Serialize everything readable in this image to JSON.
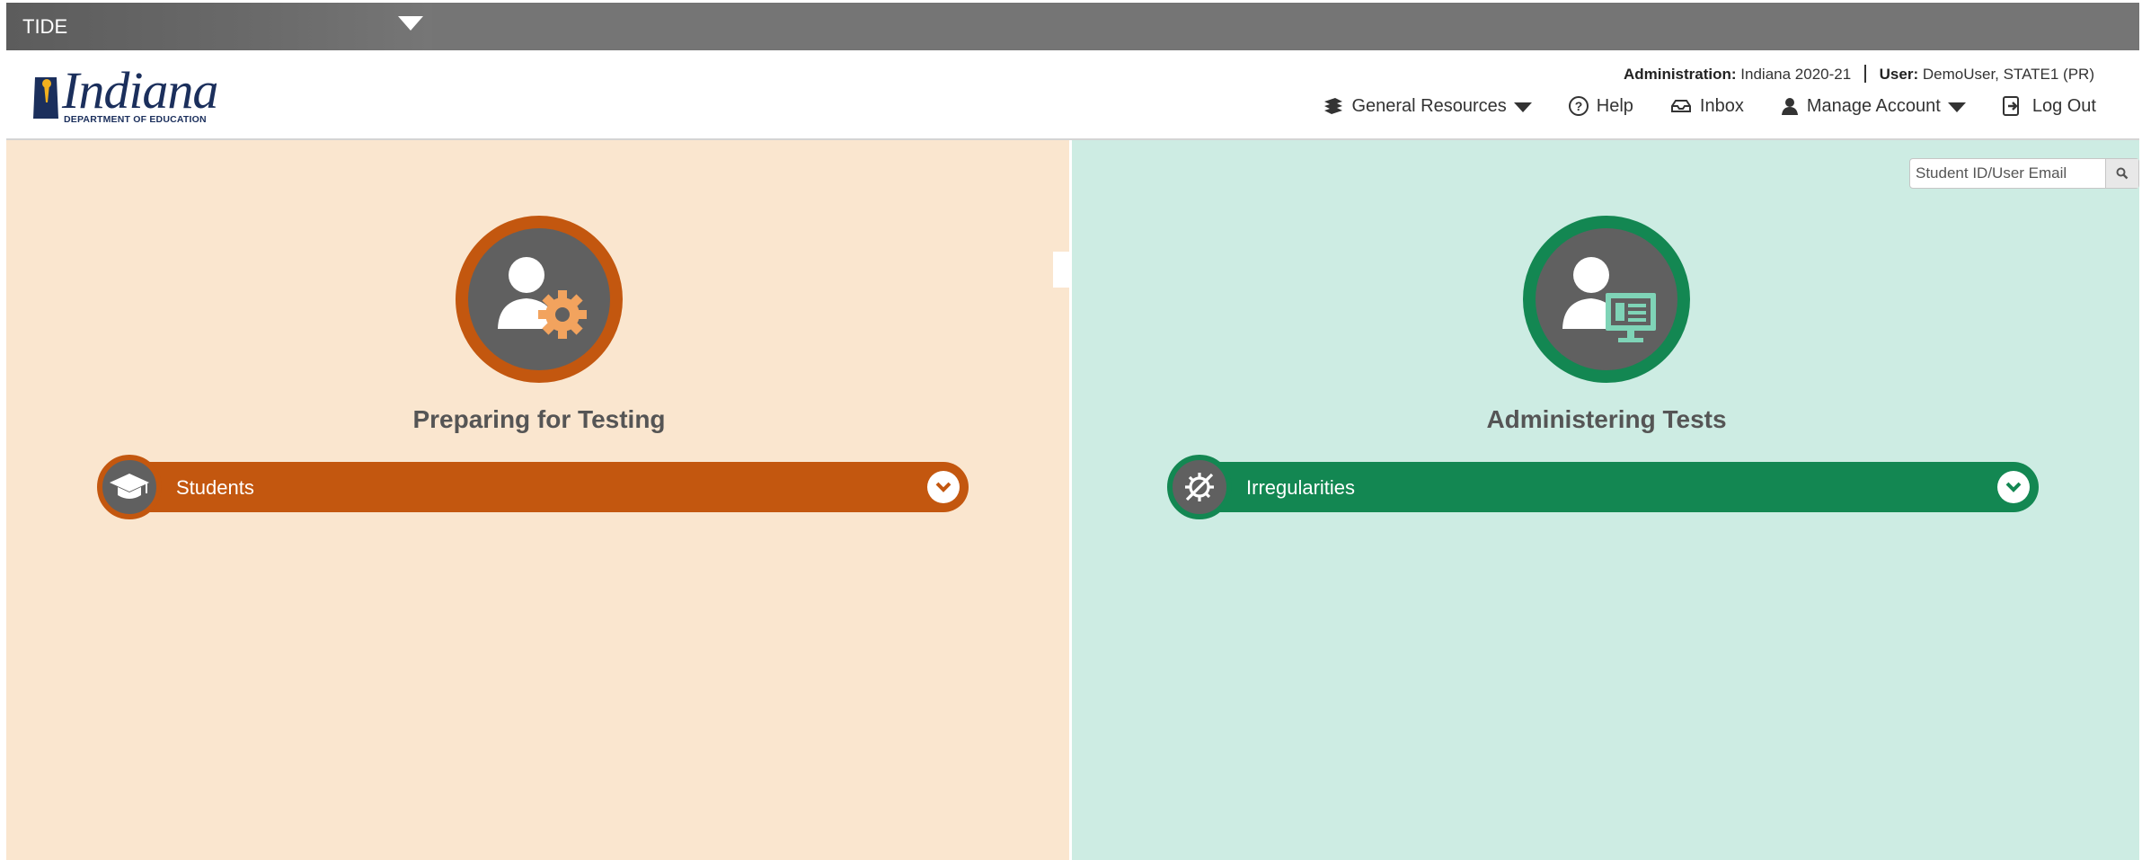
{
  "app_switcher": {
    "name": "TIDE"
  },
  "logo": {
    "word": "Indiana",
    "subtitle": "DEPARTMENT OF EDUCATION"
  },
  "header": {
    "administration_label": "Administration:",
    "administration_value": "Indiana 2020-21",
    "user_label": "User:",
    "user_value": "DemoUser, STATE1 (PR)"
  },
  "nav": {
    "general_resources": "General Resources",
    "help": "Help",
    "inbox": "Inbox",
    "manage_account": "Manage Account",
    "log_out": "Log Out"
  },
  "search": {
    "placeholder": "Student ID/User Email"
  },
  "left_panel": {
    "title": "Preparing for Testing",
    "accent": "#c3570f",
    "items": [
      {
        "label": "Students",
        "icon": "graduation-cap-icon"
      }
    ]
  },
  "right_panel": {
    "title": "Administering Tests",
    "accent": "#138752",
    "items": [
      {
        "label": "Irregularities",
        "icon": "crossed-gear-icon"
      }
    ]
  },
  "colors": {
    "left_bg": "#fae6cf",
    "right_bg": "#cdece3",
    "topbar": "#757575",
    "circle_fill": "#606060"
  }
}
